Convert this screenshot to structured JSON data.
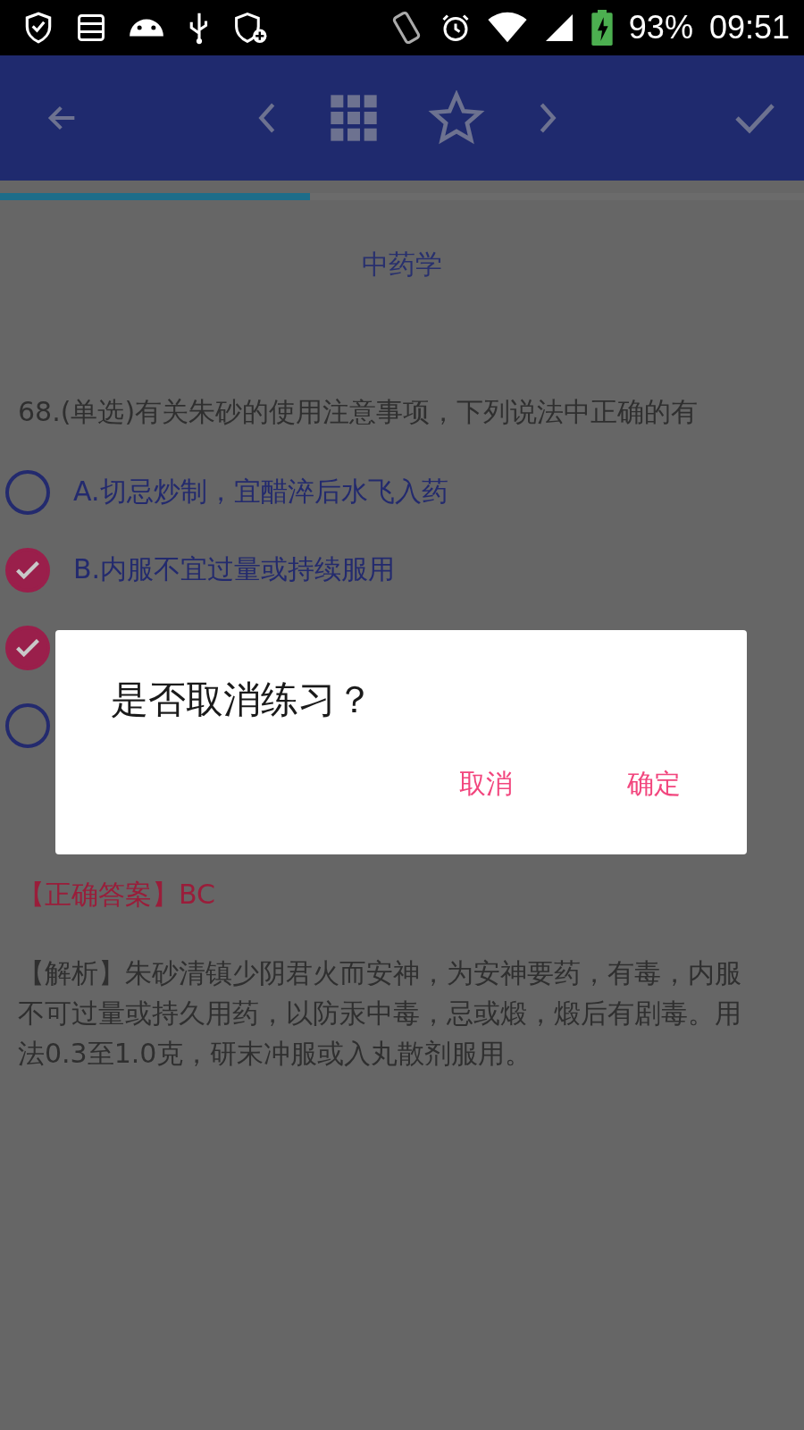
{
  "status_bar": {
    "battery": "93%",
    "time": "09:51"
  },
  "progress": {
    "level": 0.385
  },
  "subject": "中药学",
  "question": "68.(单选)有关朱砂的使用注意事项，下列说法中正确的有",
  "options": [
    {
      "label": "A.切忌炒制，宜醋淬后水飞入药",
      "checked": false
    },
    {
      "label": "B.内服不宜过量或持续服用",
      "checked": true
    },
    {
      "checked": true
    },
    {
      "checked": false
    }
  ],
  "answer": {
    "tag": "【正确答案】",
    "value": "BC"
  },
  "explanation": "【解析】朱砂清镇少阴君火而安神，为安神要药，有毒，内服不可过量或持久用药，以防汞中毒，忌或煅，煅后有剧毒。用法0.3至1.0克，研末冲服或入丸散剂服用。",
  "dialog": {
    "title": "是否取消练习？",
    "buttons": [
      "取消",
      "确定"
    ]
  }
}
